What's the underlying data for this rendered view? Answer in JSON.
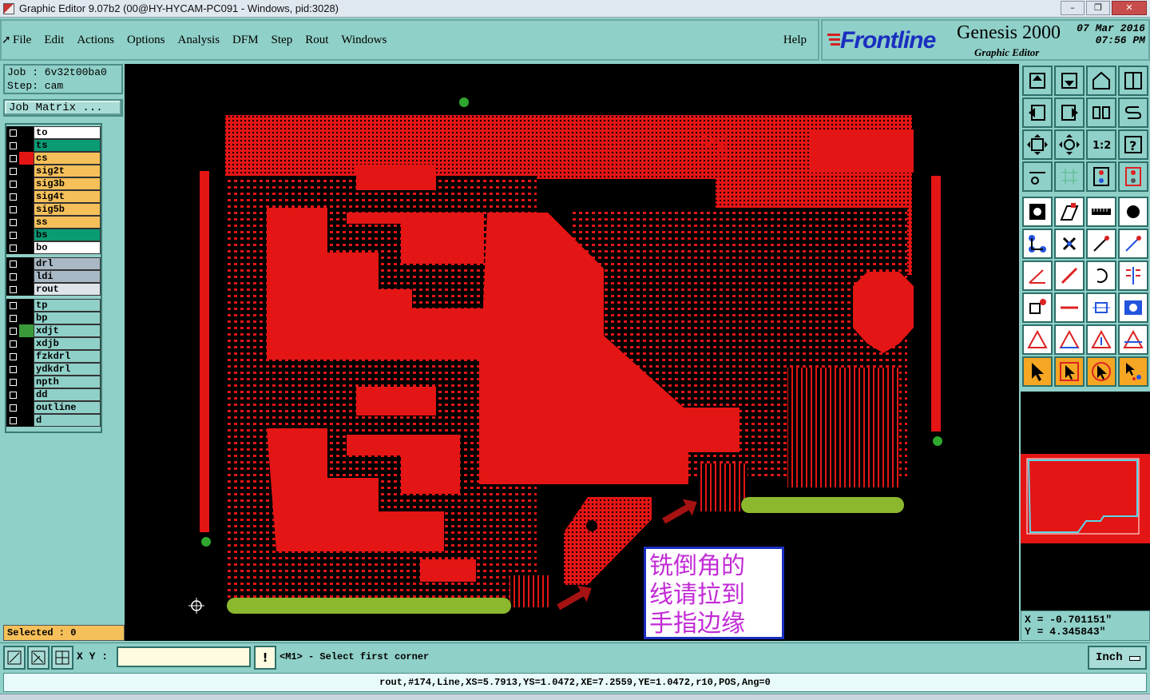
{
  "window": {
    "title": "Graphic Editor 9.07b2 (00@HY-HYCAM-PC091 - Windows, pid:3028)",
    "controls": [
      "–",
      "❐",
      "✕"
    ]
  },
  "menu": {
    "items": [
      "File",
      "Edit",
      "Actions",
      "Options",
      "Analysis",
      "DFM",
      "Step",
      "Rout",
      "Windows"
    ],
    "help": "Help"
  },
  "logo": {
    "brand": "Frontline",
    "product": "Genesis 2000",
    "subtitle": "Graphic Editor",
    "date": "07 Mar 2016",
    "time": "07:56 PM"
  },
  "job": {
    "job_line": "Job : 6v32t00ba0",
    "step_line": "Step: cam",
    "matrix_button": "Job Matrix ..."
  },
  "layers": {
    "groups": [
      [
        {
          "name": "to",
          "bg": "#ffffff",
          "swatch": "#000000"
        },
        {
          "name": "ts",
          "bg": "#0a9b73",
          "swatch": "#000000"
        },
        {
          "name": "cs",
          "bg": "#f5c05a",
          "swatch": "#e41515"
        },
        {
          "name": "sig2t",
          "bg": "#f5c05a",
          "swatch": "#000000"
        },
        {
          "name": "sig3b",
          "bg": "#f5c05a",
          "swatch": "#000000"
        },
        {
          "name": "sig4t",
          "bg": "#f5c05a",
          "swatch": "#000000"
        },
        {
          "name": "sig5b",
          "bg": "#f5c05a",
          "swatch": "#000000"
        },
        {
          "name": "ss",
          "bg": "#f5c05a",
          "swatch": "#000000"
        },
        {
          "name": "bs",
          "bg": "#0a9b73",
          "swatch": "#000000"
        },
        {
          "name": "bo",
          "bg": "#ffffff",
          "swatch": "#000000"
        }
      ],
      [
        {
          "name": "drl",
          "bg": "#a8b8c4",
          "swatch": "#000000"
        },
        {
          "name": "ldi",
          "bg": "#a8b8c4",
          "swatch": "#000000"
        },
        {
          "name": "rout",
          "bg": "#dde4ea",
          "swatch": "#000000"
        }
      ],
      [
        {
          "name": "tp",
          "bg": "#8fd0c8",
          "swatch": "#000000"
        },
        {
          "name": "bp",
          "bg": "#8fd0c8",
          "swatch": "#000000"
        },
        {
          "name": "xdjt",
          "bg": "#8fd0c8",
          "swatch": "#3a9a3a"
        },
        {
          "name": "xdjb",
          "bg": "#8fd0c8",
          "swatch": "#000000"
        },
        {
          "name": "fzkdrl",
          "bg": "#8fd0c8",
          "swatch": "#000000"
        },
        {
          "name": "ydkdrl",
          "bg": "#8fd0c8",
          "swatch": "#000000"
        },
        {
          "name": "npth",
          "bg": "#8fd0c8",
          "swatch": "#000000"
        },
        {
          "name": "dd",
          "bg": "#8fd0c8",
          "swatch": "#000000"
        },
        {
          "name": "outline",
          "bg": "#8fd0c8",
          "swatch": "#000000"
        },
        {
          "name": "d",
          "bg": "#8fd0c8",
          "swatch": "#000000"
        }
      ]
    ]
  },
  "selected": "Selected : 0",
  "annotation_note": [
    "铣倒角的",
    "线请拉到",
    "手指边缘"
  ],
  "coords": {
    "x": "X = -0.701151\"",
    "y": "Y = 4.345843\""
  },
  "bottom": {
    "xy_label": "X Y :",
    "xy_value": "",
    "bang": "!",
    "prompt": "<M1> - Select first corner",
    "units": "Inch"
  },
  "status": "rout,#174,Line,XS=5.7913,YS=1.0472,XE=7.2559,YE=1.0472,r10,POS,Ang=0",
  "colors": {
    "copper": "#e41515",
    "gold_finger": "#8cb82e",
    "bg": "#8fd0c8",
    "canvas": "#000000"
  },
  "tools": [
    "home-icon",
    "save-icon",
    "house-icon",
    "window-icon",
    "open-left-icon",
    "open-right-icon",
    "split-icon",
    "s-curve-icon",
    "fit-icon",
    "center-icon",
    "ratio-icon",
    "help-icon",
    "wrench-icon",
    "grid-icon",
    "layers-icon",
    "layers-red-icon",
    "pad-icon",
    "poly-icon",
    "ruler-icon",
    "circle-icon",
    "connect-icon",
    "cross-icon",
    "line-icon",
    "line-red-icon",
    "angle-icon",
    "slash-icon",
    "arc-icon",
    "flip-icon",
    "box-node-icon",
    "hline-icon",
    "measure-icon",
    "pad-blue-icon",
    "tri-icon",
    "tri-icon-2",
    "tri-arrow-icon",
    "tri-arrow-icon-2",
    "pointer-icon",
    "pointer-box-icon",
    "pointer-circle-icon",
    "pointer-multi-icon"
  ]
}
